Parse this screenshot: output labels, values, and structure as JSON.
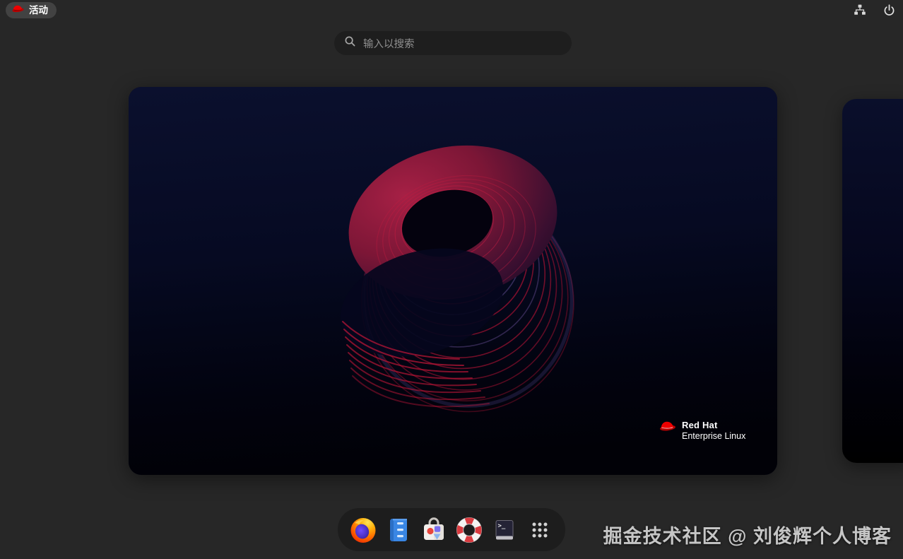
{
  "top_bar": {
    "activities_label": "活动",
    "left_icon": "redhat-fedora-icon",
    "right_icons": [
      {
        "icon": "network-wired-icon"
      },
      {
        "icon": "power-icon"
      }
    ]
  },
  "search": {
    "icon": "search-icon",
    "placeholder": "输入以搜索"
  },
  "workspace": {
    "wallpaper": "rhel9-number-nine-spiral",
    "logo_icon": "redhat-fedora-icon",
    "logo_title": "Red Hat",
    "logo_subtitle": "Enterprise Linux"
  },
  "dock": {
    "items": [
      {
        "icon": "firefox-icon"
      },
      {
        "icon": "files-icon"
      },
      {
        "icon": "software-icon"
      },
      {
        "icon": "help-lifebuoy-icon"
      },
      {
        "icon": "terminal-icon"
      },
      {
        "icon": "app-grid-icon"
      }
    ]
  },
  "watermark": {
    "text": "掘金技术社区 @ 刘俊辉个人博客"
  },
  "colors": {
    "background": "#272727",
    "dock_bg": "#1d1d1d",
    "pill_bg": "#424242",
    "search_bg": "#1e1e1e",
    "accent_red": "#ee0000",
    "wallpaper_top": "#0b102e",
    "wallpaper_bottom": "#010107",
    "nine_red": "#a31232"
  }
}
